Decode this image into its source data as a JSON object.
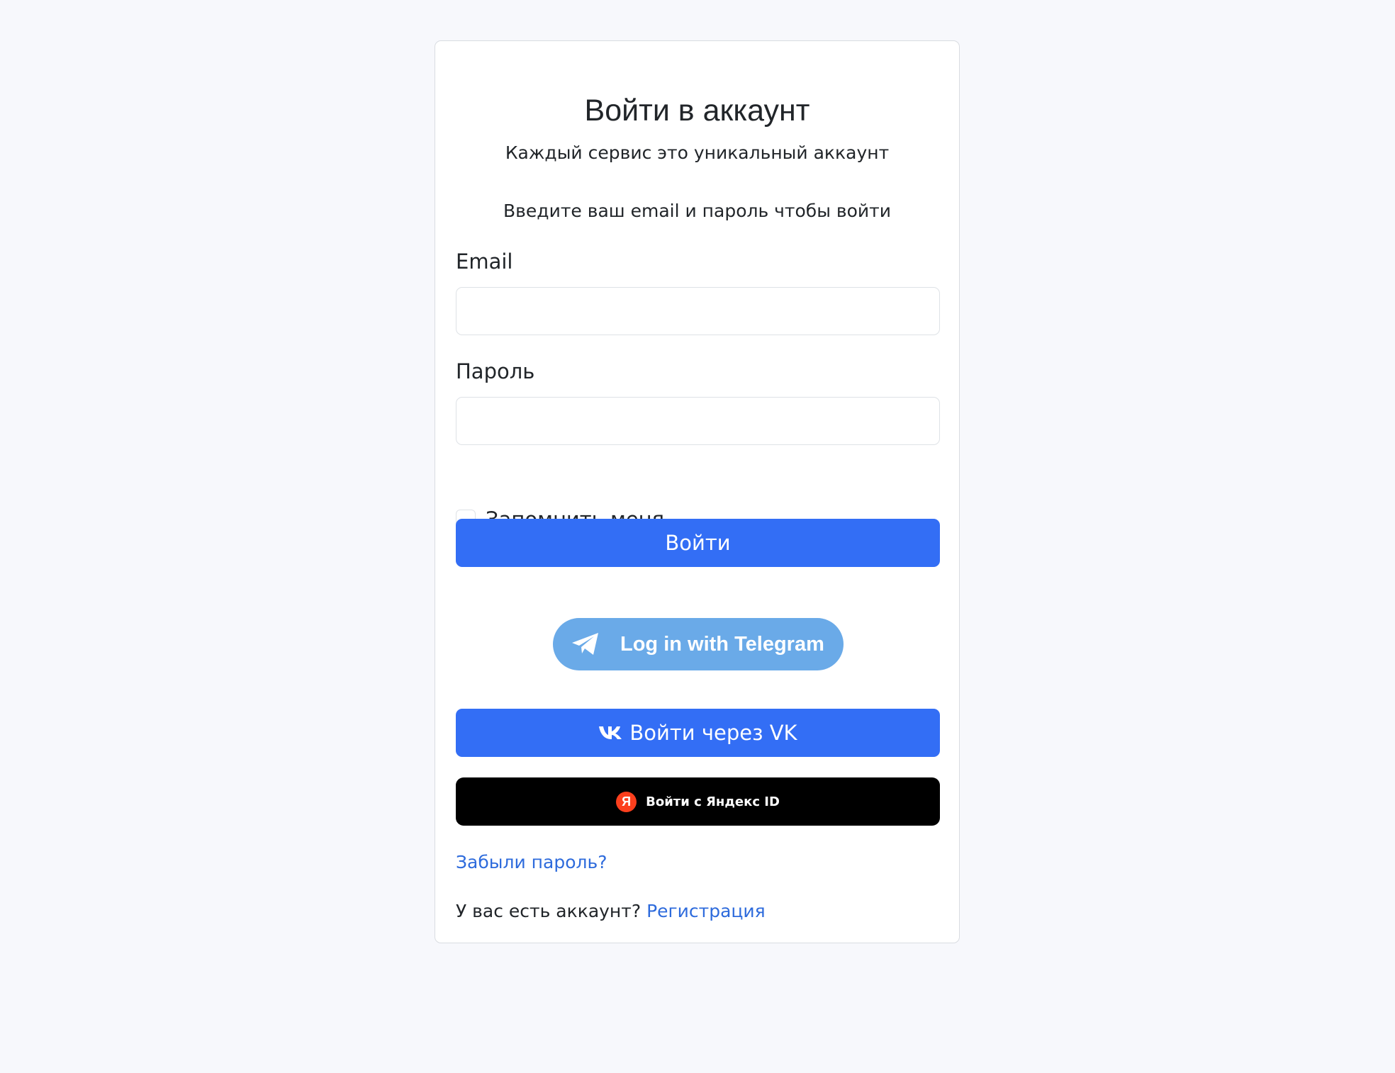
{
  "login": {
    "title": "Войти в аккаунт",
    "subtitle": "Каждый сервис это уникальный аккаунт",
    "prompt": "Введите ваш email и пароль чтобы войти",
    "email_label": "Email",
    "email_value": "",
    "password_label": "Пароль",
    "password_value": "",
    "remember_label": "Запомнить меня",
    "remember_checked": false,
    "submit_label": "Войти"
  },
  "social": {
    "telegram_label": "Log in with Telegram",
    "vk_label": "Войти через VK",
    "yandex_label": "Войти с Яндекс ID",
    "yandex_icon_letter": "Я"
  },
  "footer": {
    "forgot_label": "Забыли пароль?",
    "account_question": "У вас есть аккаунт?",
    "signup_label": "Регистрация"
  },
  "colors": {
    "page_bg": "#f7f8fc",
    "primary": "#336ef5",
    "telegram": "#6aaae8",
    "yandex_bg": "#000000",
    "yandex_red": "#fc3f1d",
    "link": "#2e6bdc"
  },
  "icons": {
    "telegram": "paper-plane-icon",
    "vk": "vk-logo-icon",
    "yandex": "yandex-logo-icon"
  }
}
